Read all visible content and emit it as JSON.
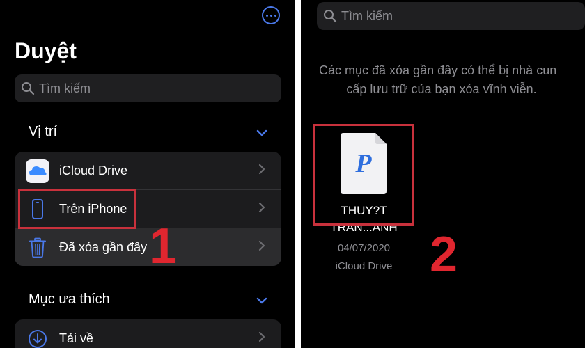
{
  "left": {
    "title": "Duyệt",
    "more_icon": "ellipsis-circle-icon",
    "search_placeholder": "Tìm kiếm",
    "locations": {
      "header": "Vị trí",
      "items": [
        {
          "label": "iCloud Drive",
          "icon": "icloud-icon"
        },
        {
          "label": "Trên iPhone",
          "icon": "iphone-icon"
        },
        {
          "label": "Đã xóa gần đây",
          "icon": "trash-icon"
        }
      ]
    },
    "favorites": {
      "header": "Mục ưa thích",
      "items": [
        {
          "label": "Tải về",
          "icon": "download-icon"
        }
      ]
    },
    "step_marker": "1"
  },
  "right": {
    "search_placeholder": "Tìm kiếm",
    "notice_line1": "Các mục đã xóa gần đây có thể bị nhà cun",
    "notice_line2": "cấp lưu trữ của bạn xóa vĩnh viễn.",
    "file": {
      "name_line1": "THUY?T",
      "name_line2": "TRAN...ANH",
      "date": "04/07/2020",
      "location": "iCloud Drive",
      "icon": "pages-document-icon",
      "icon_letter": "P"
    },
    "step_marker": "2"
  },
  "colors": {
    "accent": "#4a78e8",
    "highlight_box": "#c8313c",
    "marker": "#e0262f"
  }
}
